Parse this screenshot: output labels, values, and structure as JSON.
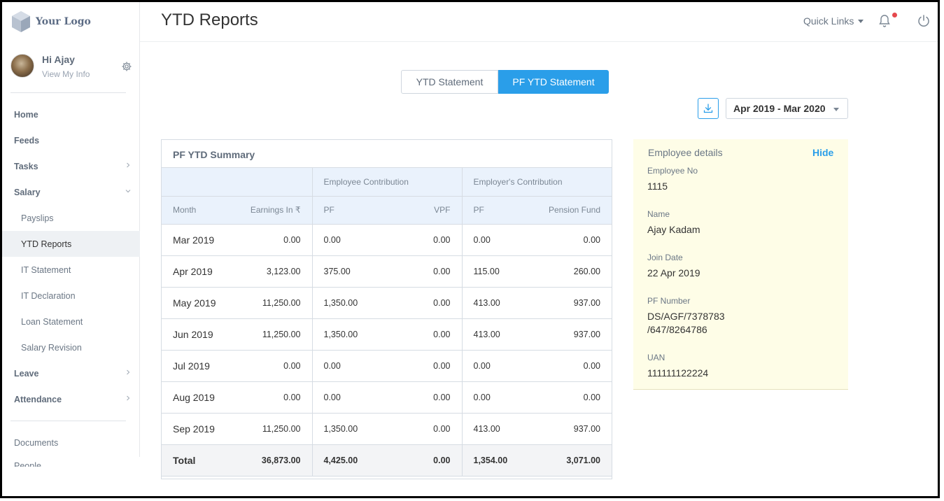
{
  "brand": {
    "logo_text": "Your Logo"
  },
  "profile": {
    "greeting": "Hi Ajay",
    "view_info": "View My Info"
  },
  "sidebar": {
    "items": [
      {
        "label": "Home"
      },
      {
        "label": "Feeds"
      },
      {
        "label": "Tasks"
      },
      {
        "label": "Salary"
      },
      {
        "label": "Payslips"
      },
      {
        "label": "YTD Reports"
      },
      {
        "label": "IT Statement"
      },
      {
        "label": "IT Declaration"
      },
      {
        "label": "Loan Statement"
      },
      {
        "label": "Salary Revision"
      },
      {
        "label": "Leave"
      },
      {
        "label": "Attendance"
      },
      {
        "label": "Documents"
      },
      {
        "label": "People"
      }
    ]
  },
  "header": {
    "title": "YTD Reports",
    "quick_links": "Quick Links"
  },
  "tabs": [
    {
      "label": "YTD Statement"
    },
    {
      "label": "PF YTD Statement"
    }
  ],
  "period": {
    "selected": "Apr 2019 - Mar 2020"
  },
  "summary": {
    "title": "PF YTD Summary",
    "group_headers": [
      "Employee Contribution",
      "Employer's Contribution"
    ],
    "columns": [
      "Month",
      "Earnings In ₹",
      "PF",
      "VPF",
      "PF",
      "Pension Fund"
    ],
    "rows": [
      [
        "Mar 2019",
        "0.00",
        "0.00",
        "0.00",
        "0.00",
        "0.00"
      ],
      [
        "Apr 2019",
        "3,123.00",
        "375.00",
        "0.00",
        "115.00",
        "260.00"
      ],
      [
        "May 2019",
        "11,250.00",
        "1,350.00",
        "0.00",
        "413.00",
        "937.00"
      ],
      [
        "Jun 2019",
        "11,250.00",
        "1,350.00",
        "0.00",
        "413.00",
        "937.00"
      ],
      [
        "Jul 2019",
        "0.00",
        "0.00",
        "0.00",
        "0.00",
        "0.00"
      ],
      [
        "Aug 2019",
        "0.00",
        "0.00",
        "0.00",
        "0.00",
        "0.00"
      ],
      [
        "Sep 2019",
        "11,250.00",
        "1,350.00",
        "0.00",
        "413.00",
        "937.00"
      ]
    ],
    "total": [
      "Total",
      "36,873.00",
      "4,425.00",
      "0.00",
      "1,354.00",
      "3,071.00"
    ]
  },
  "employee": {
    "title": "Employee details",
    "hide_label": "Hide",
    "fields": [
      {
        "label": "Employee No",
        "value": "1115"
      },
      {
        "label": "Name",
        "value": "Ajay Kadam"
      },
      {
        "label": "Join Date",
        "value": "22 Apr 2019"
      },
      {
        "label": "PF Number",
        "value_line1": "DS/AGF/7378783",
        "value_line2": "/647/8264786"
      },
      {
        "label": "UAN",
        "value": "111111122224"
      }
    ]
  },
  "colors": {
    "accent": "#2a9ee9",
    "notification": "#e5484d",
    "details_bg": "#fefde7",
    "table_header_bg": "#eaf2fc"
  },
  "icons": [
    "logo-icon",
    "gear-icon",
    "chevron-right-icon",
    "chevron-down-icon",
    "bell-icon",
    "power-icon",
    "download-icon",
    "caret-down-icon"
  ]
}
